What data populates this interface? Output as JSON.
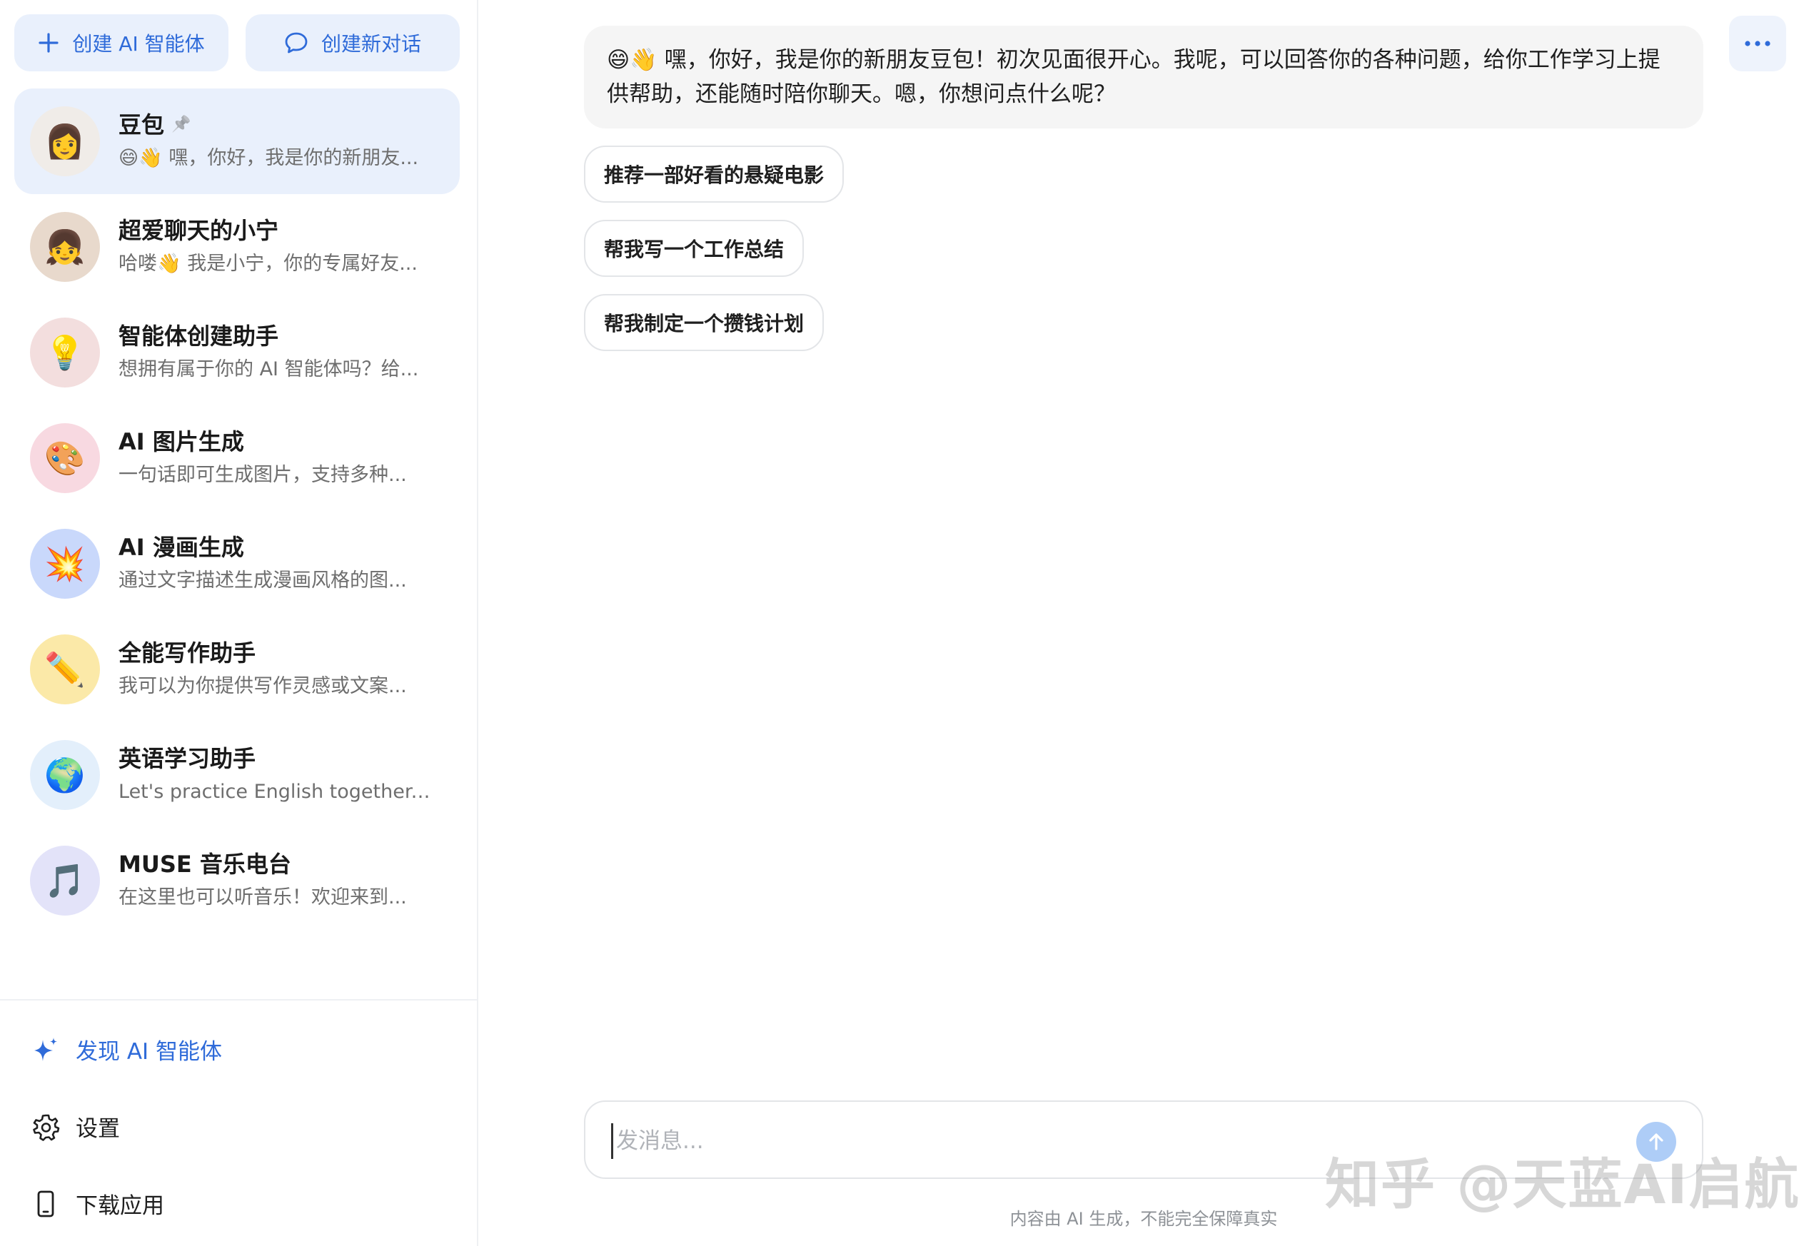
{
  "sidebar": {
    "create_agent_label": "创建 AI 智能体",
    "new_chat_label": "创建新对话",
    "agents": [
      {
        "name": "豆包",
        "preview": "😄👋 嘿，你好，我是你的新朋友...",
        "avatar": "👩",
        "avatar_bg": "#f0ece8",
        "pinned": true,
        "active": true
      },
      {
        "name": "超爱聊天的小宁",
        "preview": "哈喽👋 我是小宁，你的专属好友...",
        "avatar": "👧",
        "avatar_bg": "#e8d9cc",
        "pinned": false,
        "active": false
      },
      {
        "name": "智能体创建助手",
        "preview": "想拥有属于你的 AI 智能体吗？给...",
        "avatar": "💡",
        "avatar_bg": "#f3dede",
        "pinned": false,
        "active": false
      },
      {
        "name": "AI 图片生成",
        "preview": "一句话即可生成图片，支持多种...",
        "avatar": "🎨",
        "avatar_bg": "#f8d9e1",
        "pinned": false,
        "active": false
      },
      {
        "name": "AI 漫画生成",
        "preview": "通过文字描述生成漫画风格的图...",
        "avatar": "💥",
        "avatar_bg": "#c9d8fb",
        "pinned": false,
        "active": false
      },
      {
        "name": "全能写作助手",
        "preview": "我可以为你提供写作灵感或文案...",
        "avatar": "✏️",
        "avatar_bg": "#fbe9a8",
        "pinned": false,
        "active": false
      },
      {
        "name": "英语学习助手",
        "preview": "Let's practice English together. ...",
        "avatar": "🌍",
        "avatar_bg": "#e3effb",
        "pinned": false,
        "active": false
      },
      {
        "name": "MUSE 音乐电台",
        "preview": "在这里也可以听音乐！欢迎来到...",
        "avatar": "🎵",
        "avatar_bg": "#e3e3f9",
        "pinned": false,
        "active": false
      }
    ],
    "discover_label": "发现 AI 智能体",
    "settings_label": "设置",
    "download_label": "下载应用"
  },
  "chat": {
    "bot_message": "😄👋 嘿，你好，我是你的新朋友豆包！初次见面很开心。我呢，可以回答你的各种问题，给你工作学习上提供帮助，还能随时陪你聊天。嗯，你想问点什么呢？",
    "suggestions": [
      "推荐一部好看的悬疑电影",
      "帮我写一个工作总结",
      "帮我制定一个攒钱计划"
    ],
    "input_placeholder": "发消息...",
    "disclaimer": "内容由 AI 生成，不能完全保障真实"
  },
  "watermark": "知乎 @天蓝AI启航",
  "colors": {
    "accent": "#2f6bd9",
    "active_bg": "#e9f0fc",
    "bubble_bg": "#f5f5f5"
  }
}
